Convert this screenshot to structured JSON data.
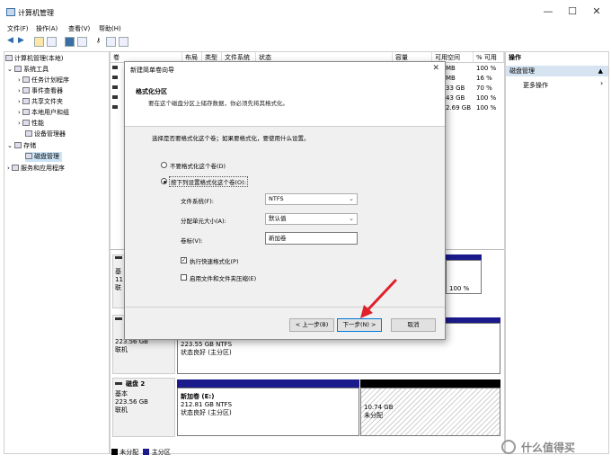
{
  "window": {
    "title": "计算机管理",
    "controls": [
      "—",
      "☐",
      "✕"
    ]
  },
  "menu": [
    "文件(F)",
    "操作(A)",
    "查看(V)",
    "帮助(H)"
  ],
  "tree": {
    "items": [
      {
        "label": "计算机管理(本地)"
      },
      {
        "label": "系统工具"
      },
      {
        "label": "任务计划程序"
      },
      {
        "label": "事件查看器"
      },
      {
        "label": "共享文件夹"
      },
      {
        "label": "本地用户和组"
      },
      {
        "label": "性能"
      },
      {
        "label": "设备管理器"
      },
      {
        "label": "存储"
      },
      {
        "label": "磁盘管理"
      },
      {
        "label": "服务和应用程序"
      }
    ]
  },
  "list": {
    "columns": [
      "卷",
      "布局",
      "类型",
      "文件系统",
      "状态",
      "容量",
      "可用空间",
      "% 可用"
    ],
    "rows": [
      {
        "free": "MB",
        "pct": "100 %"
      },
      {
        "free": "MB",
        "pct": "16 %"
      },
      {
        "free": "33 GB",
        "pct": "70 %"
      },
      {
        "free": "43 GB",
        "pct": "100 %"
      },
      {
        "free": "2.69 GB",
        "pct": "100 %"
      }
    ]
  },
  "disks": {
    "disk0": {
      "info_lines": [
        "基",
        "11",
        "联"
      ],
      "part_status": "100 %"
    },
    "disk1": {
      "info_lines": [
        "223.56 GB",
        "联机"
      ],
      "part_size": "223.55 GB NTFS",
      "part_status": "状态良好 (主分区)"
    },
    "disk2": {
      "name": "磁盘 2",
      "type": "基本",
      "size": "223.56 GB",
      "state": "联机",
      "p1_name": "新加卷 (E:)",
      "p1_size": "212.81 GB NTFS",
      "p1_status": "状态良好 (主分区)",
      "p2_size": "10.74 GB",
      "p2_status": "未分配"
    }
  },
  "legend": {
    "unallocated": "未分配",
    "primary": "主分区"
  },
  "actions": {
    "heading": "操作",
    "section": "磁盘管理",
    "more": "更多操作"
  },
  "wizard": {
    "title": "新建简单卷向导",
    "close": "✕",
    "heading": "格式化分区",
    "subheading": "要在这个磁盘分区上储存数据，你必须先将其格式化。",
    "description": "选择是否要格式化这个卷；如果要格式化，要使用什么设置。",
    "radio_no_format": "不要格式化这个卷(D)",
    "radio_format": "按下列设置格式化这个卷(O):",
    "fs_label": "文件系统(F):",
    "fs_value": "NTFS",
    "alloc_label": "分配单元大小(A):",
    "alloc_value": "默认值",
    "volume_label": "卷标(V):",
    "volume_value": "新加卷",
    "quick_format": "执行快速格式化(P)",
    "compression": "启用文件和文件夹压缩(E)",
    "back_button": "< 上一步(B)",
    "next_button": "下一步(N) >",
    "cancel_button": "取消"
  },
  "watermark": "什么值得买",
  "colors": {
    "primary_partition": "#1a1a8c",
    "disk_bar_dark": "#000000",
    "accent_arrow": "#e0202a",
    "selection": "#cce4f7"
  }
}
